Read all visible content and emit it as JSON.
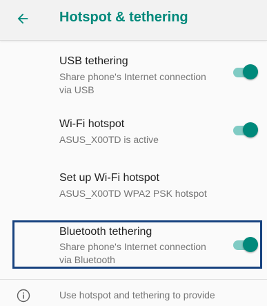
{
  "header": {
    "title": "Hotspot & tethering",
    "back_icon": "arrow-back-icon",
    "accent_color": "#00897b"
  },
  "items": [
    {
      "title": "USB tethering",
      "subtitle": "Share phone's Internet connection via USB",
      "toggle": true
    },
    {
      "title": "Wi-Fi hotspot",
      "subtitle": "ASUS_X00TD is active",
      "toggle": true
    },
    {
      "title": "Set up Wi-Fi hotspot",
      "subtitle": "ASUS_X00TD WPA2 PSK hotspot",
      "toggle": null
    },
    {
      "title": "Bluetooth tethering",
      "subtitle": "Share phone's Internet connection via Bluetooth",
      "toggle": true
    }
  ],
  "info": {
    "icon": "info-icon",
    "text": "Use hotspot and tethering to provide"
  },
  "highlight_color": "#17427f"
}
